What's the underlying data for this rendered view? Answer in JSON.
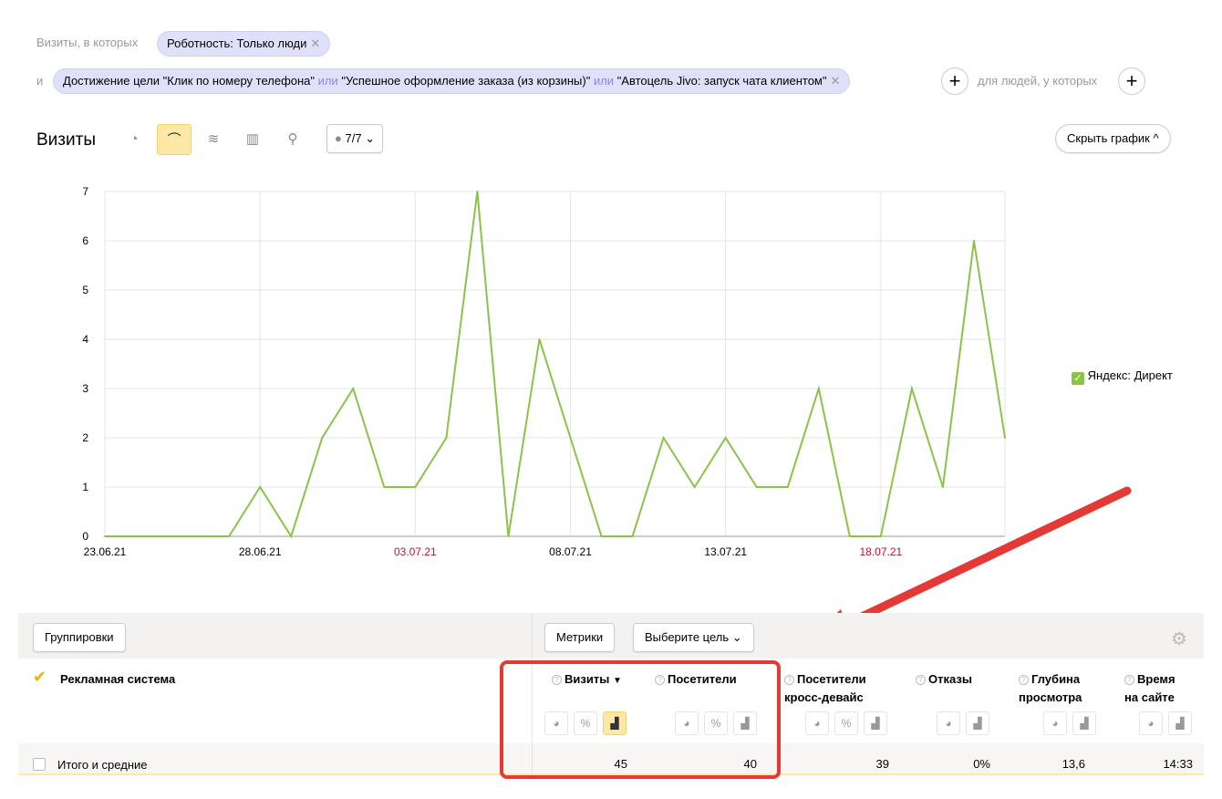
{
  "filters": {
    "visits_label": "Визиты, в которых",
    "robot_chip": "Роботность: Только люди",
    "and_label": "и",
    "goal_chip": {
      "prefix": "Достижение цели ",
      "goal1": "\"Клик по номеру телефона\"",
      "or1": "или",
      "goal2": "\"Успешное оформление заказа (из корзины)\"",
      "or2": "или",
      "goal3": "\"Автоцель Jivo: запуск чата клиентом\""
    },
    "people_label": "для людей, у которых"
  },
  "header": {
    "title": "Визиты",
    "segments_count": "7/7",
    "hide_chart": "Скрыть график"
  },
  "legend": {
    "label": "Яндекс: Директ"
  },
  "chart_data": {
    "type": "line",
    "title": "Визиты",
    "x": [
      "23.06",
      "24.06",
      "25.06",
      "26.06",
      "27.06",
      "28.06",
      "29.06",
      "30.06",
      "01.07",
      "02.07",
      "03.07",
      "04.07",
      "05.07",
      "06.07",
      "07.07",
      "08.07",
      "09.07",
      "10.07",
      "11.07",
      "12.07",
      "13.07",
      "14.07",
      "15.07",
      "16.07",
      "17.07",
      "18.07",
      "19.07",
      "20.07",
      "21.07",
      "22.07"
    ],
    "series": [
      {
        "name": "Яндекс: Директ",
        "color": "#8bc34a",
        "values": [
          0,
          0,
          0,
          0,
          0,
          1,
          0,
          2,
          3,
          1,
          1,
          2,
          7,
          0,
          4,
          2,
          0,
          0,
          2,
          1,
          2,
          1,
          1,
          3,
          0,
          0,
          3,
          1,
          6,
          2
        ]
      }
    ],
    "xticks": [
      {
        "label": "23.06.21",
        "index": 0,
        "weekend": false
      },
      {
        "label": "28.06.21",
        "index": 5,
        "weekend": false
      },
      {
        "label": "03.07.21",
        "index": 10,
        "weekend": true
      },
      {
        "label": "08.07.21",
        "index": 15,
        "weekend": false
      },
      {
        "label": "13.07.21",
        "index": 20,
        "weekend": false
      },
      {
        "label": "18.07.21",
        "index": 25,
        "weekend": true
      }
    ],
    "yticks": [
      "0",
      "1",
      "2",
      "3",
      "4",
      "5",
      "6",
      "7"
    ],
    "ylim": [
      0,
      7
    ],
    "grid": true,
    "legend": "right"
  },
  "table": {
    "groupings": "Группировки",
    "metrics": "Метрики",
    "choose_goal": "Выберите цель",
    "dimension": "Рекламная система",
    "columns": [
      {
        "l1": "Визиты",
        "l2": "",
        "sort": "▼",
        "value": "45"
      },
      {
        "l1": "Посетители",
        "l2": "",
        "value": "40"
      },
      {
        "l1": "Посетители",
        "l2": "кросс-девайс",
        "value": "39"
      },
      {
        "l1": "Отказы",
        "l2": "",
        "value": "0%"
      },
      {
        "l1": "Глубина",
        "l2": "просмотра",
        "value": "13,6"
      },
      {
        "l1": "Время",
        "l2": "на сайте",
        "value": "14:33"
      }
    ],
    "totals_label": "Итого и средние"
  },
  "colors": {
    "accent": "#fde9a5",
    "chip": "#e0e0fb",
    "line": "#8bc34a",
    "weekend": "#c8102e",
    "arrow": "#e53935"
  }
}
